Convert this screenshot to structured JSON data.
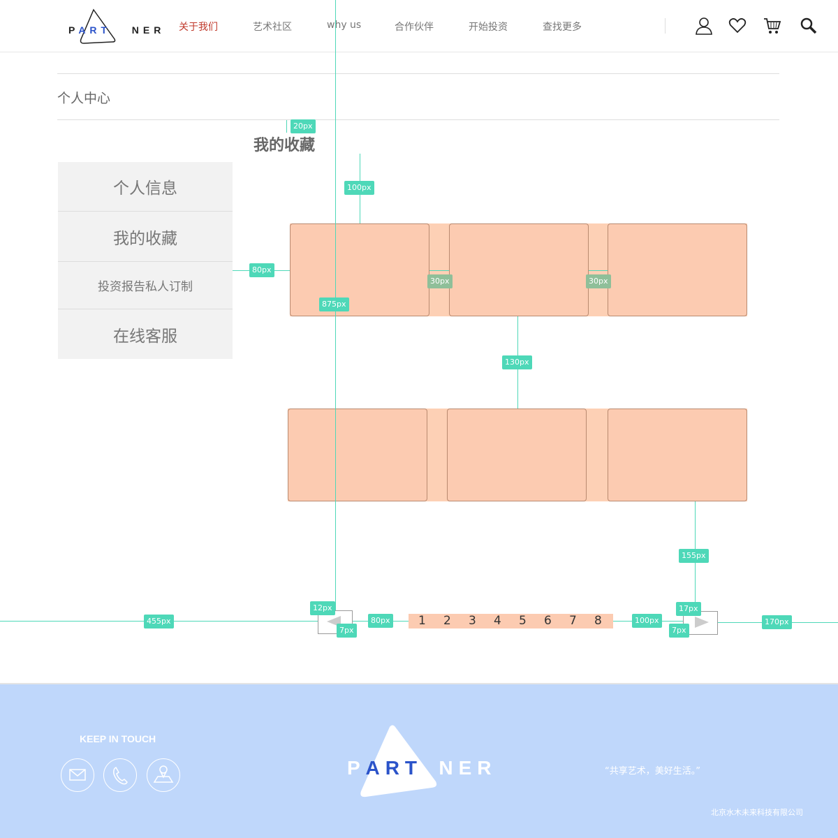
{
  "header": {
    "logo": {
      "text_left": "P",
      "text_art": "ART",
      "text_right": "NER"
    },
    "nav": [
      {
        "label": "关于我们",
        "active": true
      },
      {
        "label": "艺术社区"
      },
      {
        "label": "why us"
      },
      {
        "label": "合作伙伴"
      },
      {
        "label": "开始投资"
      },
      {
        "label": "查找更多"
      }
    ],
    "icons": [
      "user-icon",
      "heart-icon",
      "cart-icon",
      "search-icon"
    ]
  },
  "breadcrumb": "个人中心",
  "section_title": "我的收藏",
  "sidebar": {
    "items": [
      {
        "label": "个人信息"
      },
      {
        "label": "我的收藏"
      },
      {
        "label": "投资报告私人订制"
      },
      {
        "label": "在线客服"
      }
    ]
  },
  "annotations": {
    "a20": "20px",
    "a100": "100px",
    "a80": "80px",
    "a30a": "30px",
    "a30b": "30px",
    "a875": "875px",
    "a130": "130px",
    "a155": "155px",
    "a455": "455px",
    "a12": "12px",
    "a7a": "7px",
    "a80b": "80px",
    "a100b": "100px",
    "a17": "17px",
    "a7b": "7px",
    "a170": "170px"
  },
  "pagination": {
    "pages": [
      "1",
      "2",
      "3",
      "4",
      "5",
      "6",
      "7",
      "8"
    ]
  },
  "footer": {
    "keep_in_touch": "KEEP IN TOUCH",
    "icons": [
      "mail-icon",
      "phone-icon",
      "map-icon"
    ],
    "logo": {
      "text_left": "P",
      "text_art": "ART",
      "text_right": "NER"
    },
    "slogan": "“共享艺术，美好生活。”",
    "company": "北京水木未来科技有限公司"
  },
  "colors": {
    "accent": "#c0392b",
    "card": "#fccbb1",
    "annotation": "#4ed8b8",
    "footer": "#bfd7fb",
    "logo_blue": "#2b53c9"
  }
}
